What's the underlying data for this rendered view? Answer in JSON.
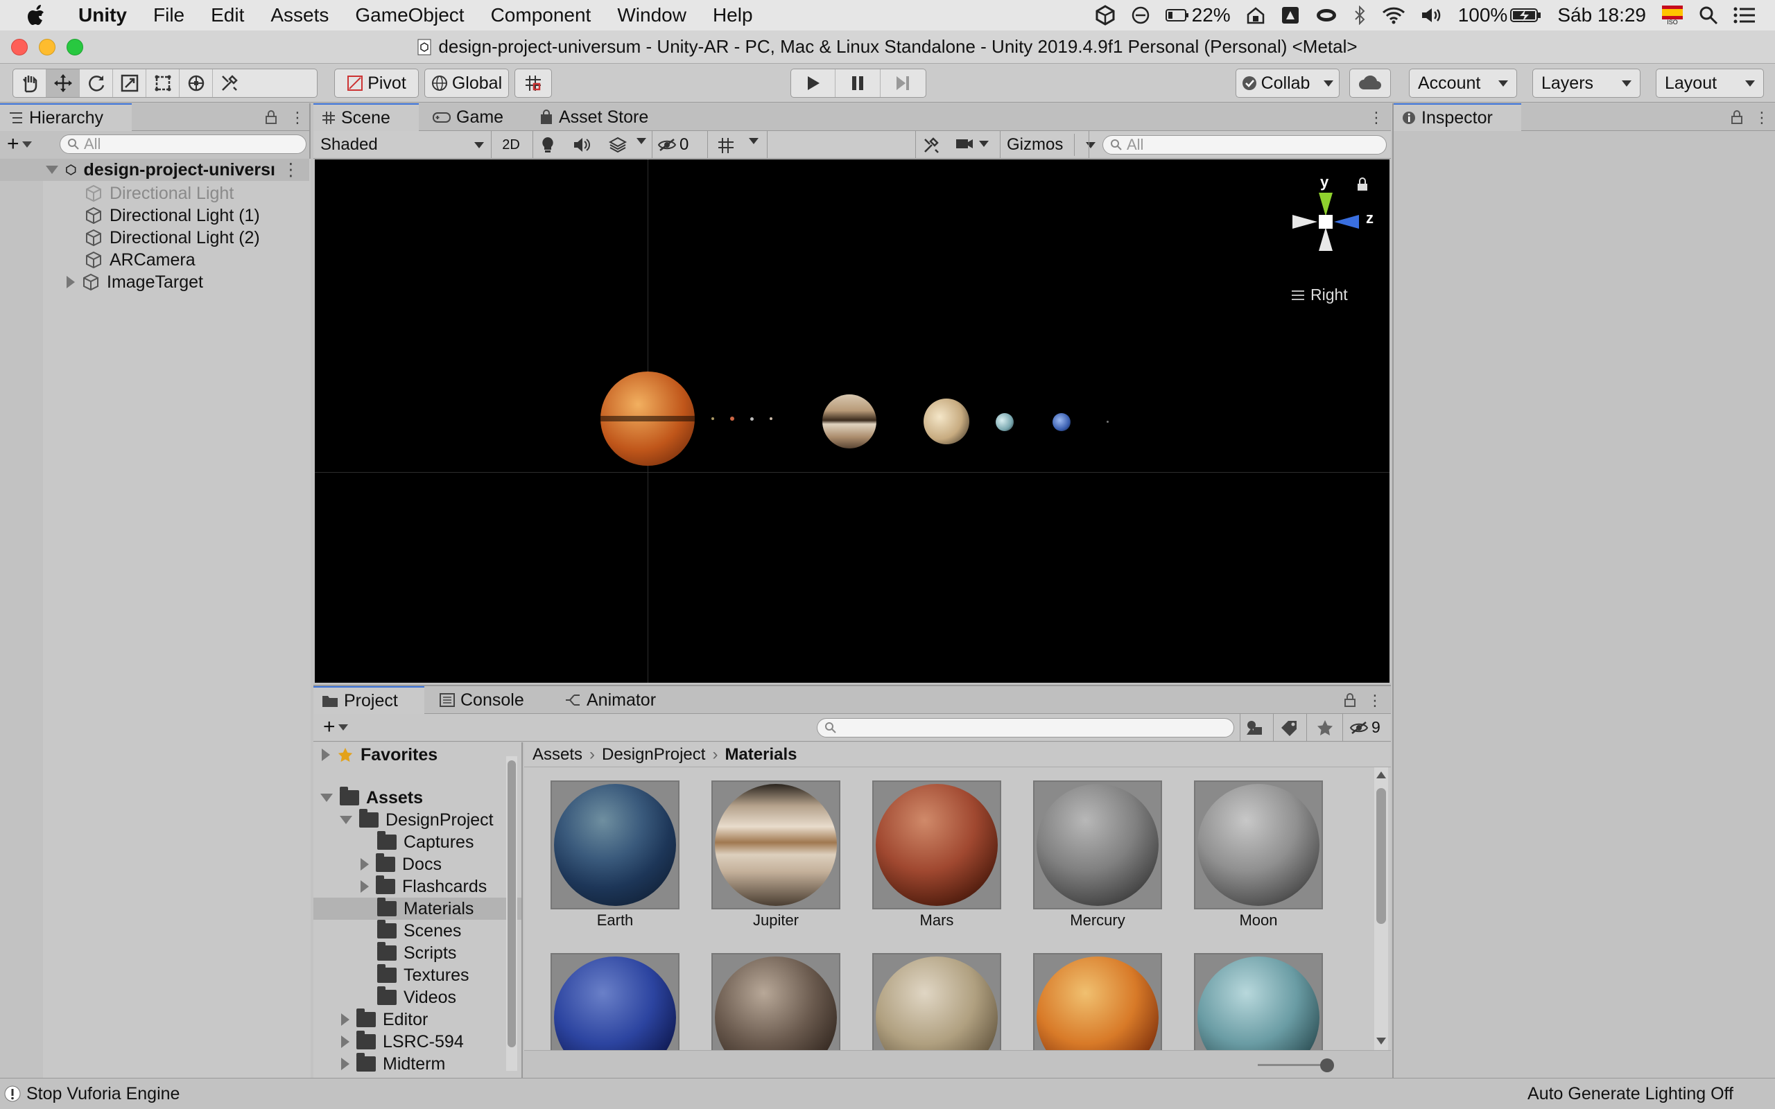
{
  "menubar": {
    "app": "Unity",
    "items": [
      "File",
      "Edit",
      "Assets",
      "GameObject",
      "Component",
      "Window",
      "Help"
    ],
    "battery_small": "22%",
    "battery": "100%",
    "clock": "Sáb 18:29",
    "flag_label": "ISO"
  },
  "window": {
    "title": "design-project-universum - Unity-AR - PC, Mac & Linux Standalone - Unity 2019.4.9f1 Personal (Personal) <Metal>"
  },
  "toolbar": {
    "pivot": "Pivot",
    "global": "Global",
    "collab": "Collab",
    "account": "Account",
    "layers": "Layers",
    "layout": "Layout"
  },
  "hierarchy": {
    "tab": "Hierarchy",
    "search_placeholder": "All",
    "scene_name": "design-project-universı",
    "items": [
      "Directional Light",
      "Directional Light (1)",
      "Directional Light (2)",
      "ARCamera",
      "ImageTarget"
    ]
  },
  "scene_view": {
    "tabs": [
      "Scene",
      "Game",
      "Asset Store"
    ],
    "shading": "Shaded",
    "mode_2d": "2D",
    "hidden_count": "0",
    "gizmos": "Gizmos",
    "search_placeholder": "All",
    "gizmo_y": "y",
    "gizmo_z": "z",
    "view_label": "Right"
  },
  "inspector": {
    "tab": "Inspector"
  },
  "project": {
    "tabs": [
      "Project",
      "Console",
      "Animator"
    ],
    "hidden_count": "9",
    "favorites": "Favorites",
    "tree": {
      "assets": "Assets",
      "design_project": "DesignProject",
      "children": [
        "Captures",
        "Docs",
        "Flashcards",
        "Materials",
        "Scenes",
        "Scripts",
        "Textures",
        "Videos"
      ],
      "others": [
        "Editor",
        "LSRC-594",
        "Midterm"
      ]
    },
    "breadcrumb": [
      "Assets",
      "DesignProject",
      "Materials"
    ],
    "materials_row1": [
      "Earth",
      "Jupiter",
      "Mars",
      "Mercury",
      "Moon"
    ]
  },
  "status": {
    "left": "Stop Vuforia Engine",
    "right": "Auto Generate Lighting Off"
  },
  "colors": {
    "accent": "#3a72d8",
    "gizmo_y": "#8fd12e",
    "gizmo_z": "#3a6fe0"
  }
}
